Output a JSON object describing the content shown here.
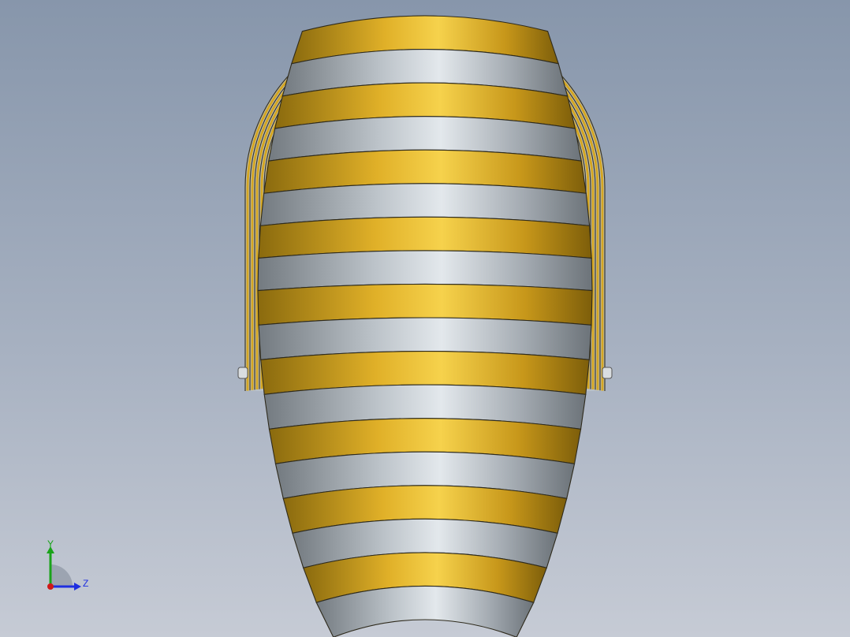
{
  "viewport": {
    "colors": {
      "background_top": "#8796ab",
      "background_bottom": "#c6cbd5",
      "gold_band": "#e4b52c",
      "silver_band": "#b7bfc6",
      "outline": "#3a3420"
    }
  },
  "model": {
    "name_icon": "corrugated-elbow-duct-icon",
    "front_band_count": 18,
    "back_band_count": 11
  },
  "triad": {
    "y_label": "Y",
    "z_label": "Z",
    "colors": {
      "y": "#1aa31a",
      "z": "#1f2fe0",
      "x": "#d01818"
    }
  }
}
